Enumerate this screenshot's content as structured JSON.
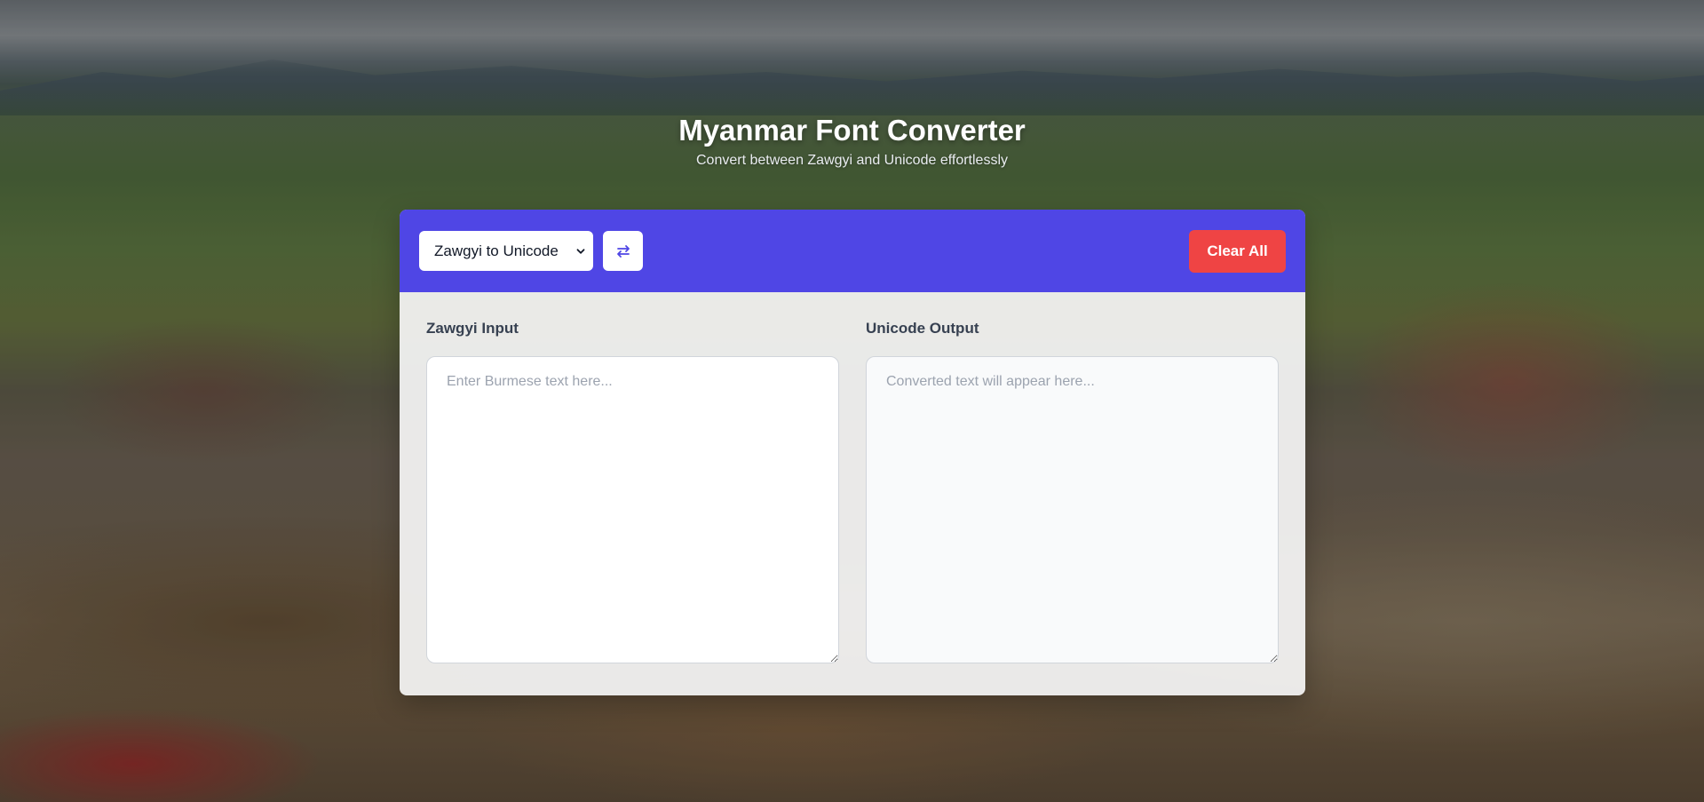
{
  "header": {
    "title": "Myanmar Font Converter",
    "subtitle": "Convert between Zawgyi and Unicode effortlessly"
  },
  "toolbar": {
    "mode_select": {
      "selected": "Zawgyi to Unicode"
    },
    "swap_icon": "swap-arrows-icon",
    "clear_label": "Clear All"
  },
  "input_pane": {
    "label": "Zawgyi Input",
    "placeholder": "Enter Burmese text here...",
    "value": ""
  },
  "output_pane": {
    "label": "Unicode Output",
    "placeholder": "Converted text will appear here...",
    "value": ""
  },
  "colors": {
    "accent": "#4f46e5",
    "danger": "#ef4444",
    "card_bg": "#f5f5f5",
    "output_bg": "#f9fafb"
  }
}
